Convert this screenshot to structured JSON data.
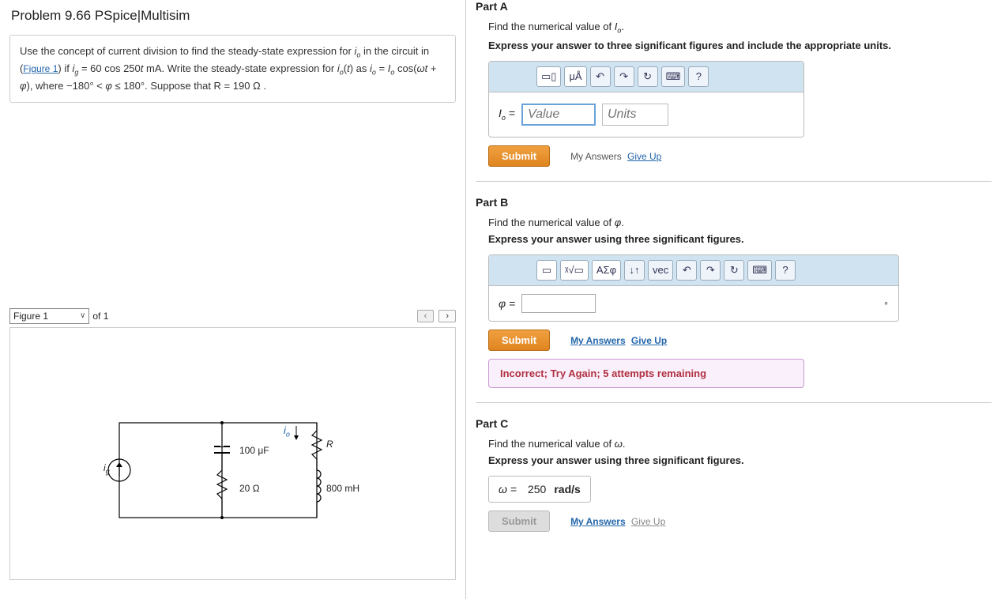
{
  "title": "Problem 9.66 PSpice|Multisim",
  "description_plain": "Use the concept of current division to find the steady-state expression for i_o in the circuit in (Figure 1) if i_g = 60 cos 250t mA. Write the steady-state expression for i_o(t) as i_o = I_o cos(ωt + φ), where −180° < φ ≤ 180°. Suppose that R = 190 Ω .",
  "figure_link": "Figure 1",
  "figure": {
    "select_label": "Figure 1",
    "count_label": "of 1",
    "prev": "‹",
    "next": "›",
    "components": {
      "source": "iₐ",
      "cap": "100 μF",
      "res_series": "20 Ω",
      "io_label": "i₀",
      "R": "R",
      "L": "800 mH"
    }
  },
  "partA": {
    "title": "Part A",
    "prompt_prefix": "Find the numerical value of ",
    "prompt_symbol": "I₀",
    "instruction": "Express your answer to three significant figures and include the appropriate units.",
    "eq_label": "I₀ =",
    "value_placeholder": "Value",
    "units_placeholder": "Units",
    "tool_uA": "μÅ",
    "tool_q": "?",
    "submit": "Submit",
    "my_answers": "My Answers",
    "give_up": "Give Up"
  },
  "partB": {
    "title": "Part B",
    "prompt_prefix": "Find the numerical value of ",
    "prompt_symbol": "φ",
    "instruction": "Express your answer using three significant figures.",
    "eq_label": "φ =",
    "deg_unit": "∘",
    "tool_greek": "ΑΣφ",
    "tool_arrow": "↓↑",
    "tool_vec": "vec",
    "tool_q": "?",
    "submit": "Submit",
    "my_answers": "My Answers",
    "give_up": "Give Up",
    "feedback": "Incorrect; Try Again; 5 attempts remaining"
  },
  "partC": {
    "title": "Part C",
    "prompt_prefix": "Find the numerical value of ",
    "prompt_symbol": "ω",
    "instruction": "Express your answer using three significant figures.",
    "eq_label": "ω =",
    "value": "250",
    "units": "rad/s",
    "submit": "Submit",
    "my_answers": "My Answers",
    "give_up": "Give Up"
  }
}
